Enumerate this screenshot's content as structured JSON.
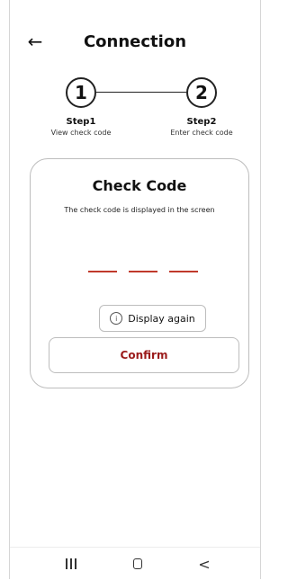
{
  "header": {
    "back_icon": "arrow-left-icon",
    "title": "Connection"
  },
  "stepper": {
    "steps": [
      {
        "number": "1",
        "title": "Step1",
        "subtitle": "View check code"
      },
      {
        "number": "2",
        "title": "Step2",
        "subtitle": "Enter check code"
      }
    ]
  },
  "card": {
    "title": "Check Code",
    "description": "The check code is displayed in the screen",
    "code_slots": [
      "",
      "",
      ""
    ],
    "display_again_label": "Display again",
    "info_icon": "i",
    "confirm_label": "Confirm"
  },
  "navbar": {
    "recent_icon": "recent-apps-icon",
    "home_icon": "home-icon",
    "back_icon": "back-chevron-icon",
    "back_glyph": "<"
  },
  "colors": {
    "accent": "#9b1b1b",
    "code_slot": "#c0392b",
    "border": "#bdbdbd"
  }
}
